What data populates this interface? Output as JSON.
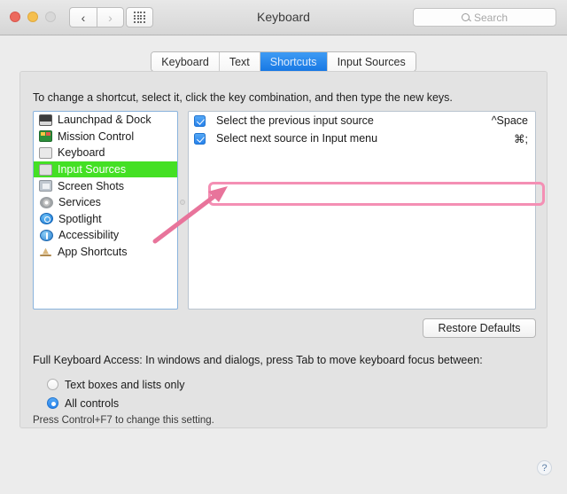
{
  "window": {
    "title": "Keyboard",
    "traffic_lights": [
      "close",
      "minimize",
      "zoom"
    ],
    "nav_back": "‹",
    "nav_forward": "›",
    "grid_icon": "show-all-icon"
  },
  "search": {
    "placeholder": "Search",
    "value": "",
    "icon": "search-icon"
  },
  "tabs": [
    {
      "label": "Keyboard",
      "active": false
    },
    {
      "label": "Text",
      "active": false
    },
    {
      "label": "Shortcuts",
      "active": true
    },
    {
      "label": "Input Sources",
      "active": false
    }
  ],
  "panel": {
    "hint": "To change a shortcut, select it, click the key combination, and then type the new keys."
  },
  "sidebar": {
    "items": [
      {
        "label": "Launchpad & Dock",
        "icon": "dock-icon",
        "selected": false
      },
      {
        "label": "Mission Control",
        "icon": "mission-control-icon",
        "selected": false
      },
      {
        "label": "Keyboard",
        "icon": "keyboard-icon",
        "selected": false
      },
      {
        "label": "Input Sources",
        "icon": "input-sources-icon",
        "selected": true
      },
      {
        "label": "Screen Shots",
        "icon": "screenshot-icon",
        "selected": false
      },
      {
        "label": "Services",
        "icon": "services-gear-icon",
        "selected": false
      },
      {
        "label": "Spotlight",
        "icon": "spotlight-icon",
        "selected": false
      },
      {
        "label": "Accessibility",
        "icon": "accessibility-icon",
        "selected": false
      },
      {
        "label": "App Shortcuts",
        "icon": "app-shortcuts-icon",
        "selected": false
      }
    ]
  },
  "shortcuts": [
    {
      "label": "Select the previous input source",
      "key": "^Space",
      "checked": true,
      "highlighted": true
    },
    {
      "label": "Select next source in Input menu",
      "key": "⌘;",
      "checked": true,
      "highlighted": false
    }
  ],
  "buttons": {
    "restore_defaults": "Restore Defaults"
  },
  "full_keyboard_access": {
    "label": "Full Keyboard Access: In windows and dialogs, press Tab to move keyboard focus between:",
    "options": [
      {
        "label": "Text boxes and lists only",
        "selected": false
      },
      {
        "label": "All controls",
        "selected": true
      }
    ],
    "note": "Press Control+F7 to change this setting."
  },
  "help": {
    "label": "?"
  },
  "colors": {
    "tab_active": "#1878e4",
    "sidebar_selected": "#44e024",
    "annotation": "#f48fb4",
    "checkbox": "#2782ec"
  }
}
